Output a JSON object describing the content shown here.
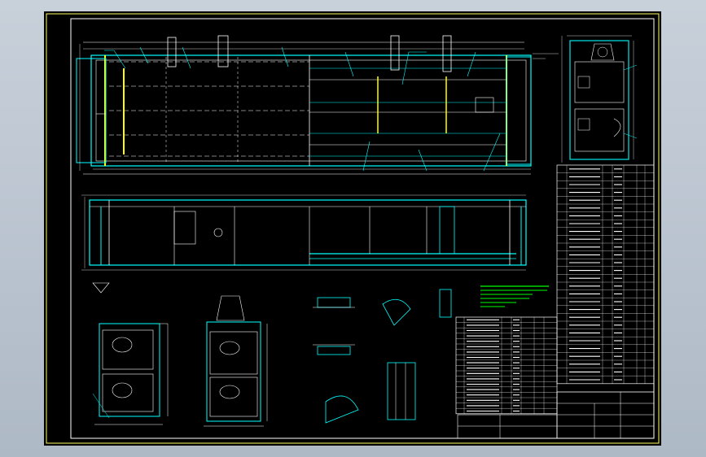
{
  "colors": {
    "background": "#000000",
    "frame": "#ffff66",
    "outline": "#00ffff",
    "detail": "#ffffff",
    "annotation": "#00ff00",
    "hidden": "#ffff00",
    "leader": "#00ffff"
  },
  "parts_table_right": {
    "rows": 28
  },
  "parts_table_bottom": {
    "rows": 18
  }
}
